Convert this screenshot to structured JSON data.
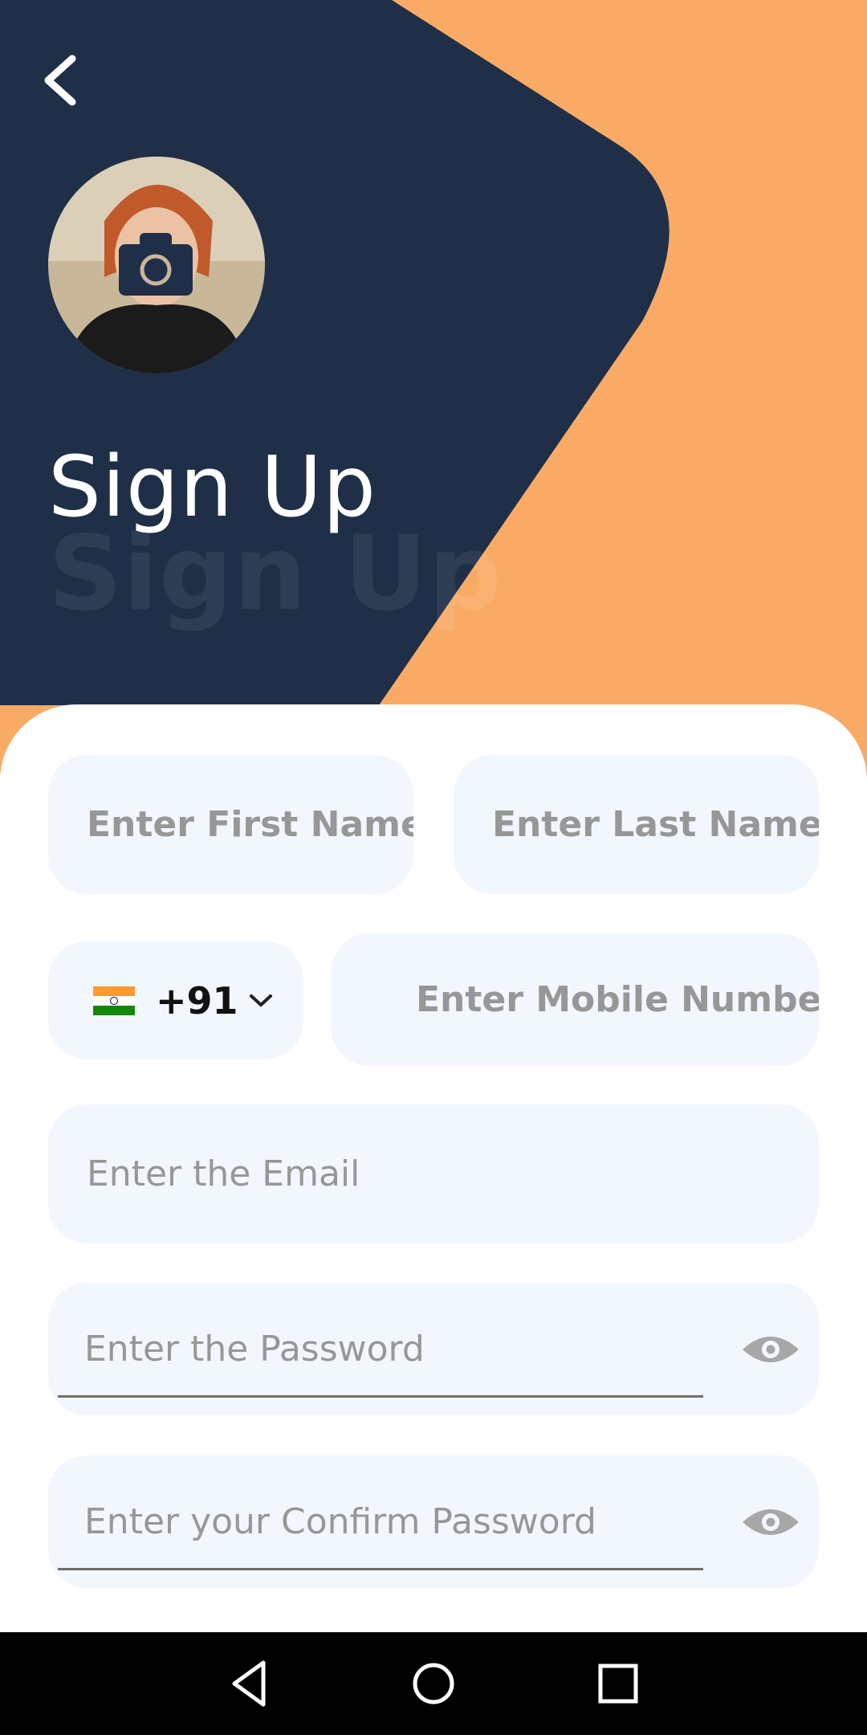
{
  "header": {
    "title": "Sign Up",
    "title_shadow": "Sign Up",
    "back_icon": "chevron-left-icon",
    "avatar_icon": "avatar",
    "camera_icon": "camera-icon"
  },
  "form": {
    "first_name_placeholder": "Enter First Name",
    "last_name_placeholder": "Enter Last Name",
    "country_code": "+91",
    "country_flag": "india-flag-icon",
    "mobile_placeholder": "Enter Mobile Number",
    "email_placeholder": "Enter the Email",
    "password_placeholder": "Enter the Password",
    "confirm_password_placeholder": "Enter your Confirm Password",
    "visibility_icon": "eye-icon"
  },
  "navigation": {
    "back": "triangle-back-icon",
    "home": "circle-home-icon",
    "recents": "square-recents-icon"
  },
  "colors": {
    "navy": "#1F2F48",
    "orange": "#F9AB66",
    "field_bg": "#F2F7FE",
    "placeholder": "#979797"
  }
}
